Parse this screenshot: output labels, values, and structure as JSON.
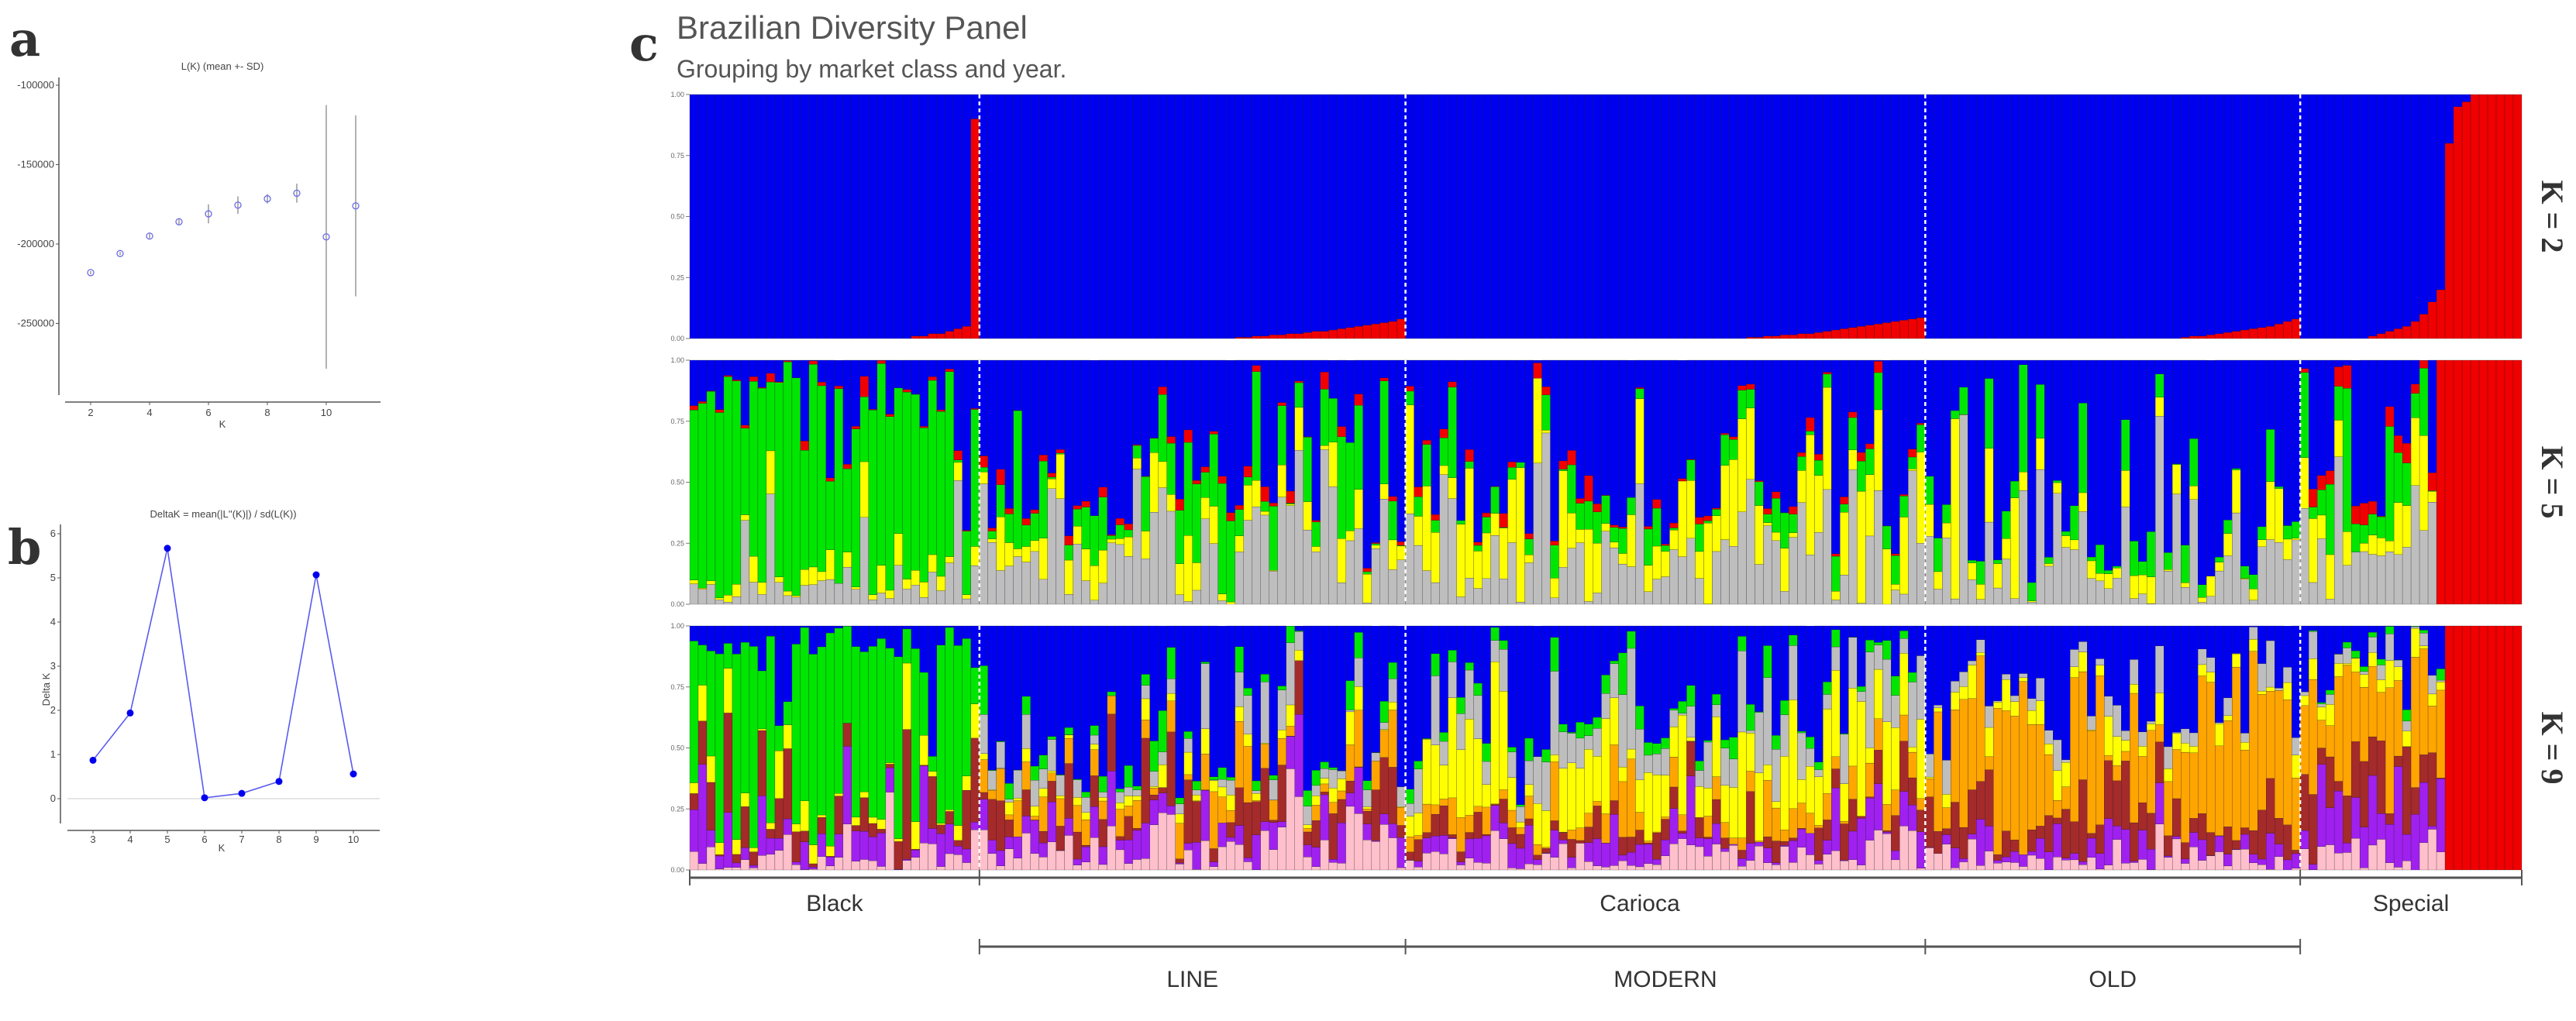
{
  "labels": {
    "a": "a",
    "b": "b",
    "c": "c"
  },
  "chart_data": [
    {
      "type": "scatter",
      "title": "L(K) (mean +- SD)",
      "xlabel": "K",
      "ylabel": "",
      "xlim": [
        1,
        12
      ],
      "ylim": [
        -290000,
        -95000
      ],
      "xticks": [
        2,
        4,
        6,
        8,
        10
      ],
      "yticks": [
        -100000,
        -150000,
        -200000,
        -250000
      ],
      "ytick_labels": [
        "-100000",
        "-150000",
        "-200000",
        "-250000"
      ],
      "color": "#6a6ae8",
      "points": [
        {
          "k": 2,
          "mean": -218000,
          "sd": 1000
        },
        {
          "k": 3,
          "mean": -206000,
          "sd": 1000
        },
        {
          "k": 4,
          "mean": -195000,
          "sd": 1500
        },
        {
          "k": 5,
          "mean": -186000,
          "sd": 1500
        },
        {
          "k": 6,
          "mean": -181000,
          "sd": 6000
        },
        {
          "k": 7,
          "mean": -175500,
          "sd": 5500
        },
        {
          "k": 8,
          "mean": -171500,
          "sd": 3000
        },
        {
          "k": 9,
          "mean": -168000,
          "sd": 6000
        },
        {
          "k": 10,
          "mean": -195500,
          "sd": 83000
        },
        {
          "k": 11,
          "mean": -176000,
          "sd": 57000
        }
      ]
    },
    {
      "type": "line",
      "title": "DeltaK = mean(|L''(K)|) / sd(L(K))",
      "xlabel": "K",
      "ylabel": "Delta K",
      "xlim": [
        2.3,
        10.7
      ],
      "ylim": [
        -0.55,
        6.2
      ],
      "xticks": [
        3,
        4,
        5,
        6,
        7,
        8,
        9,
        10
      ],
      "yticks": [
        0,
        1,
        2,
        3,
        4,
        5,
        6
      ],
      "color": "#0000ee",
      "x": [
        3,
        4,
        5,
        6,
        7,
        8,
        9,
        10
      ],
      "y": [
        0.87,
        1.94,
        5.67,
        0.02,
        0.12,
        0.39,
        5.07,
        0.56
      ]
    },
    {
      "type": "bar",
      "subtype": "stacked-admixture",
      "title": "Brazilian Diversity Panel",
      "subtitle": "Grouping by market class and year.",
      "yticks": [
        "0.00",
        "0.25",
        "0.50",
        "0.75",
        "1.00"
      ],
      "ylim": [
        0,
        1
      ],
      "groups": [
        {
          "name": "Black",
          "n": 34
        },
        {
          "name": "LINE",
          "n": 50
        },
        {
          "name": "MODERN",
          "n": 61
        },
        {
          "name": "OLD",
          "n": 44
        },
        {
          "name": "Special",
          "n": 26
        }
      ],
      "market_classes": [
        {
          "label": "Black",
          "groups": [
            "Black"
          ]
        },
        {
          "label": "Carioca",
          "groups": [
            "LINE",
            "MODERN",
            "OLD"
          ]
        },
        {
          "label": "Special",
          "groups": [
            "Special"
          ]
        }
      ],
      "year_classes": [
        "LINE",
        "MODERN",
        "OLD"
      ],
      "cluster_colors": {
        "blue": "#0000f0",
        "red": "#f00000",
        "green": "#00e600",
        "yellow": "#ffff00",
        "gray": "#bebebe",
        "orange": "#ffa500",
        "brown": "#a52a2a",
        "purple": "#a020f0",
        "pink": "#ffc0cb"
      },
      "rows": [
        {
          "label": "K = 2",
          "k": 2,
          "stack_order": [
            "red",
            "blue"
          ],
          "red_fraction": {
            "Black": [
              0,
              0,
              0,
              0,
              0,
              0,
              0,
              0,
              0,
              0,
              0,
              0,
              0,
              0,
              0,
              0,
              0,
              0,
              0,
              0,
              0,
              0,
              0,
              0,
              0,
              0,
              0.01,
              0.01,
              0.02,
              0.02,
              0.03,
              0.04,
              0.05,
              0.9
            ],
            "LINE": [
              0,
              0,
              0,
              0,
              0,
              0,
              0,
              0,
              0,
              0,
              0,
              0,
              0,
              0,
              0,
              0,
              0,
              0,
              0,
              0,
              0,
              0,
              0,
              0,
              0,
              0,
              0,
              0,
              0,
              0,
              0.005,
              0.005,
              0.01,
              0.01,
              0.015,
              0.015,
              0.02,
              0.02,
              0.025,
              0.03,
              0.03,
              0.035,
              0.04,
              0.045,
              0.05,
              0.055,
              0.06,
              0.065,
              0.07,
              0.08
            ],
            "MODERN": [
              0,
              0,
              0,
              0,
              0,
              0,
              0,
              0,
              0,
              0,
              0,
              0,
              0,
              0,
              0,
              0,
              0,
              0,
              0,
              0,
              0,
              0,
              0,
              0,
              0,
              0,
              0,
              0,
              0,
              0,
              0,
              0,
              0,
              0,
              0,
              0,
              0,
              0,
              0,
              0,
              0.005,
              0.005,
              0.01,
              0.01,
              0.015,
              0.015,
              0.02,
              0.02,
              0.025,
              0.03,
              0.035,
              0.04,
              0.045,
              0.05,
              0.055,
              0.06,
              0.065,
              0.07,
              0.075,
              0.08,
              0.085
            ],
            "OLD": [
              0,
              0,
              0,
              0,
              0,
              0,
              0,
              0,
              0,
              0,
              0,
              0,
              0,
              0,
              0,
              0,
              0,
              0,
              0,
              0,
              0,
              0,
              0,
              0,
              0,
              0,
              0,
              0,
              0,
              0,
              0.005,
              0.01,
              0.01,
              0.015,
              0.02,
              0.025,
              0.03,
              0.035,
              0.04,
              0.045,
              0.05,
              0.06,
              0.07,
              0.08
            ],
            "Special": [
              0,
              0,
              0,
              0,
              0,
              0,
              0,
              0,
              0.01,
              0.02,
              0.03,
              0.04,
              0.05,
              0.07,
              0.1,
              0.15,
              0.2,
              0.8,
              0.95,
              0.97,
              1,
              1,
              1,
              1,
              1,
              1
            ]
          }
        },
        {
          "label": "K = 5",
          "k": 5,
          "stack_order": [
            "gray",
            "yellow",
            "green",
            "red",
            "blue"
          ],
          "fully_red_tail": {
            "Special": 10
          },
          "group_means": {
            "Black": {
              "gray": 0.08,
              "yellow": 0.04,
              "green": 0.7,
              "red": 0.01,
              "blue": 0.17
            },
            "LINE": {
              "gray": 0.2,
              "yellow": 0.08,
              "green": 0.15,
              "red": 0.02,
              "blue": 0.55
            },
            "MODERN": {
              "gray": 0.2,
              "yellow": 0.2,
              "green": 0.08,
              "red": 0.02,
              "blue": 0.5
            },
            "OLD": {
              "gray": 0.15,
              "yellow": 0.07,
              "green": 0.08,
              "red": 0.0,
              "blue": 0.7
            },
            "Special": {
              "gray": 0.25,
              "yellow": 0.1,
              "green": 0.15,
              "red": 0.05,
              "blue": 0.45
            }
          }
        },
        {
          "label": "K = 9",
          "k": 9,
          "stack_order": [
            "pink",
            "purple",
            "brown",
            "orange",
            "yellow",
            "gray",
            "green",
            "red",
            "blue"
          ],
          "fully_red_tail": {
            "Special": 9
          },
          "group_means": {
            "Black": {
              "pink": 0.05,
              "purple": 0.1,
              "brown": 0.1,
              "orange": 0.0,
              "yellow": 0.05,
              "gray": 0.0,
              "green": 0.6,
              "red": 0.0,
              "blue": 0.1
            },
            "LINE": {
              "pink": 0.08,
              "purple": 0.1,
              "brown": 0.12,
              "orange": 0.1,
              "yellow": 0.03,
              "gray": 0.07,
              "green": 0.05,
              "red": 0.0,
              "blue": 0.45
            },
            "MODERN": {
              "pink": 0.06,
              "purple": 0.07,
              "brown": 0.08,
              "orange": 0.08,
              "yellow": 0.2,
              "gray": 0.12,
              "green": 0.04,
              "red": 0.0,
              "blue": 0.35
            },
            "OLD": {
              "pink": 0.05,
              "purple": 0.05,
              "brown": 0.1,
              "orange": 0.45,
              "yellow": 0.05,
              "gray": 0.05,
              "green": 0.0,
              "red": 0.0,
              "blue": 0.25
            },
            "Special": {
              "pink": 0.08,
              "purple": 0.15,
              "brown": 0.15,
              "orange": 0.35,
              "yellow": 0.05,
              "gray": 0.05,
              "green": 0.02,
              "red": 0.0,
              "blue": 0.15
            }
          }
        }
      ]
    }
  ]
}
